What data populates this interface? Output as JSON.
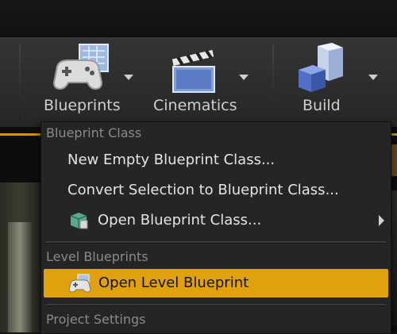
{
  "toolbar": {
    "buttons": [
      {
        "label": "Blueprints",
        "icon": "gamepad-blueprint-icon"
      },
      {
        "label": "Cinematics",
        "icon": "clapperboard-icon"
      },
      {
        "label": "Build",
        "icon": "build-cubes-icon"
      }
    ]
  },
  "menu": {
    "sections": {
      "blueprint_class": "Blueprint Class",
      "level_blueprints": "Level Blueprints",
      "project_settings": "Project Settings"
    },
    "items": {
      "new_empty": "New Empty Blueprint Class...",
      "convert_selection": "Convert Selection to Blueprint Class...",
      "open_blueprint_class": "Open Blueprint Class...",
      "open_level_blueprint": "Open Level Blueprint"
    },
    "icons": {
      "open_blueprint_class": "blueprint-class-open-icon",
      "open_level_blueprint": "level-blueprint-icon"
    },
    "highlighted": "open_level_blueprint"
  },
  "colors": {
    "highlight": "#e0a20b",
    "menu_bg": "#252525",
    "toolbar_bg": "#2e2e2e",
    "accent_line": "#c99a1a"
  }
}
